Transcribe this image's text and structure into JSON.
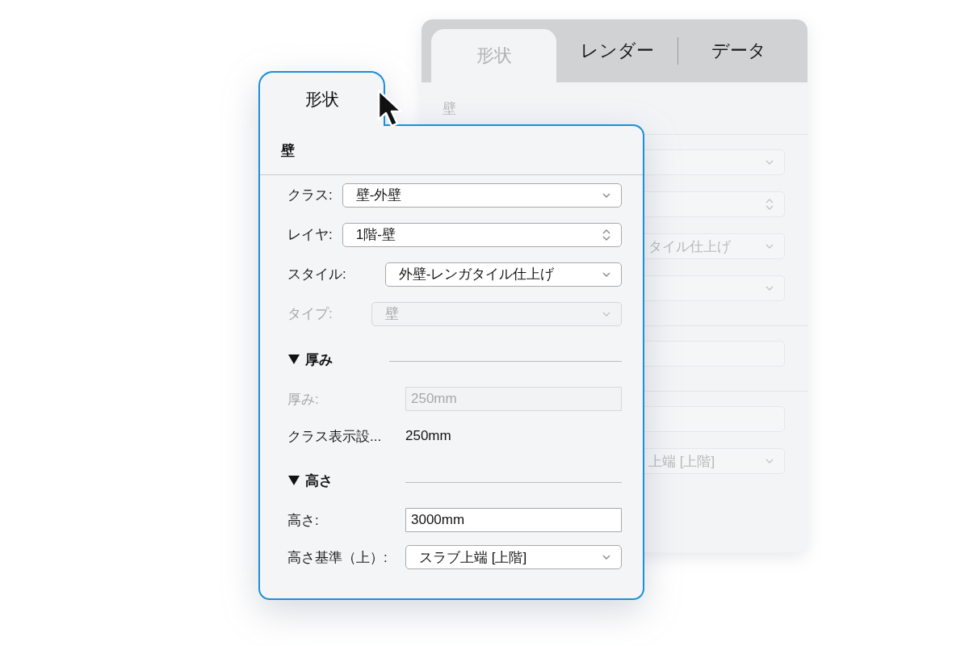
{
  "back_panel": {
    "tabs": [
      {
        "label": "形状",
        "selected": true
      },
      {
        "label": "レンダー",
        "selected": false
      },
      {
        "label": "データ",
        "selected": false
      }
    ],
    "section_title": "壁",
    "sections": [
      {
        "fields": [
          {
            "kind": "select"
          },
          {
            "kind": "stepper"
          },
          {
            "kind": "select",
            "value": "タイル仕上げ"
          },
          {
            "kind": "select"
          }
        ]
      },
      {
        "fields": [
          {
            "kind": "input"
          }
        ]
      },
      {
        "fields": [
          {
            "kind": "input"
          },
          {
            "kind": "select",
            "value": "上端 [上階]"
          }
        ]
      }
    ]
  },
  "floating_panel": {
    "tab": {
      "label": "形状"
    },
    "section_title": "壁",
    "sections": [
      {
        "rows": [
          {
            "label": "クラス:",
            "kind": "select",
            "value": "壁-外壁",
            "disabled": false
          },
          {
            "label": "レイヤ:",
            "kind": "stepper",
            "value": "1階-壁",
            "disabled": false
          },
          {
            "label": "スタイル:",
            "kind": "select",
            "value": "外壁-レンガタイル仕上げ",
            "disabled": false
          },
          {
            "label": "タイプ:",
            "kind": "select",
            "value": "壁",
            "disabled": true
          }
        ]
      },
      {
        "title": "厚み",
        "expanded": true,
        "rows": [
          {
            "label": "厚み:",
            "kind": "input",
            "value": "250mm",
            "disabled": true
          },
          {
            "label": "クラス表示設...",
            "kind": "text",
            "value": "250mm",
            "disabled": false
          }
        ]
      },
      {
        "title": "高さ",
        "expanded": true,
        "rows": [
          {
            "label": "高さ:",
            "kind": "input",
            "value": "3000mm",
            "disabled": false
          },
          {
            "label": "高さ基準（上）:",
            "kind": "select",
            "value": "スラブ上端 [上階]",
            "disabled": false
          }
        ]
      }
    ]
  }
}
